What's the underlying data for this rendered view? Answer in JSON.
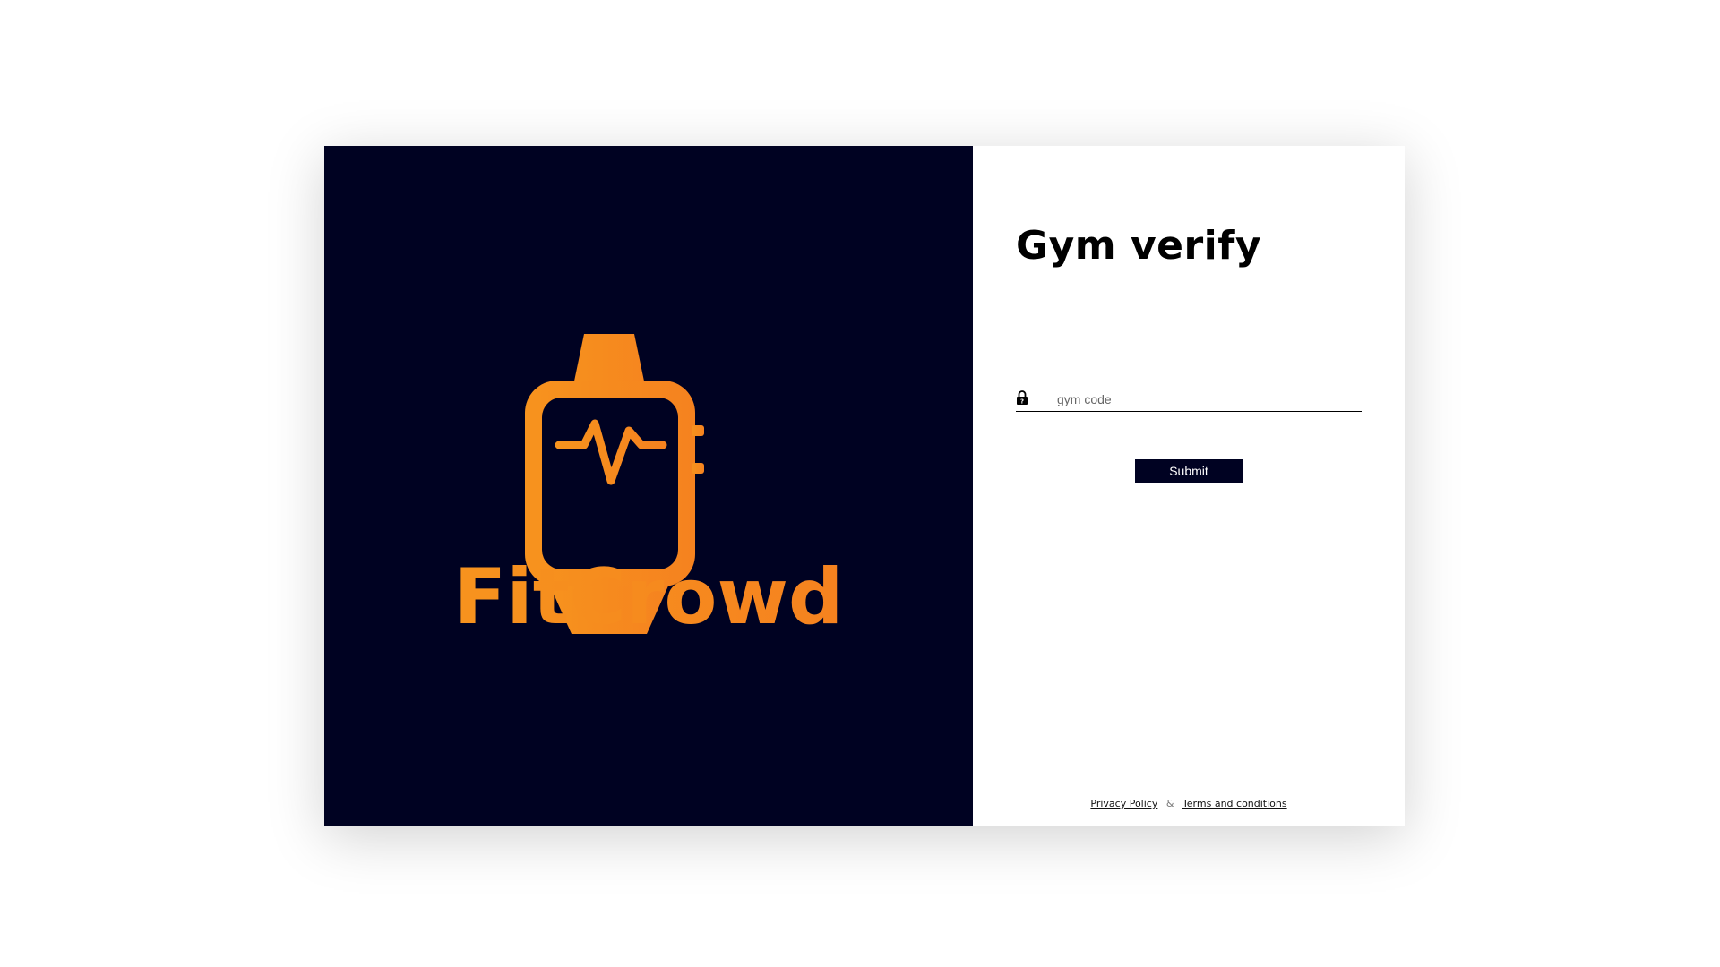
{
  "brand": {
    "name": "FitCrowd",
    "logo_icon": "smartwatch-heartbeat-icon",
    "colors": {
      "panel_bg": "#000222",
      "accent": "#f7931e"
    }
  },
  "form": {
    "title": "Gym verify",
    "gym_code": {
      "value": "",
      "placeholder": "gym code",
      "icon": "lock-icon"
    },
    "submit_label": "Submit"
  },
  "footer": {
    "privacy_label": "Privacy Policy",
    "separator": "&",
    "terms_label": "Terms and conditions"
  }
}
